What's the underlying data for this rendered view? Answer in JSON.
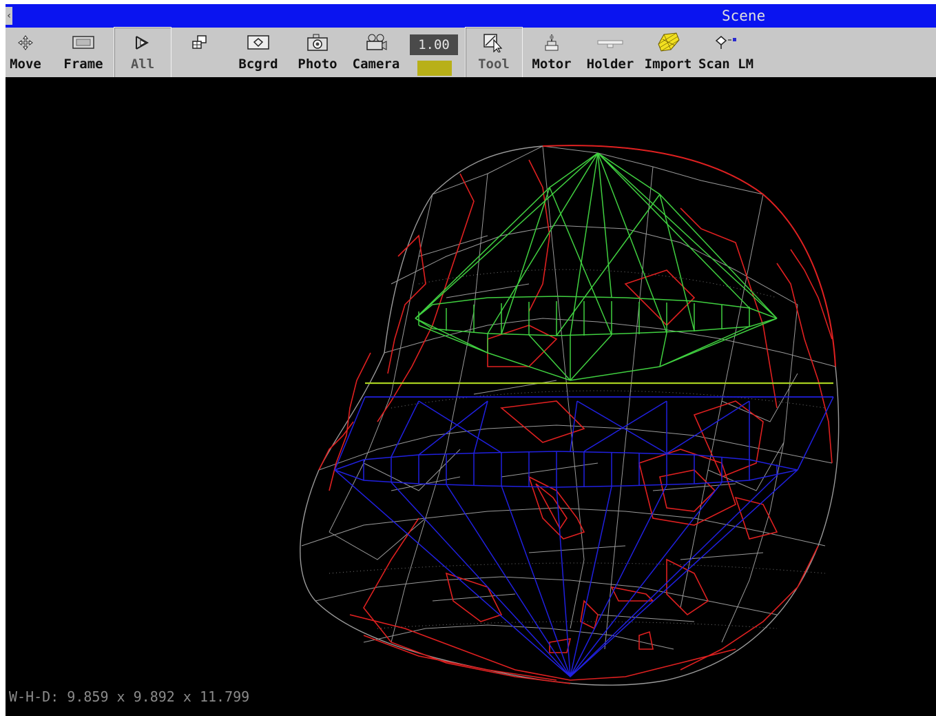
{
  "window": {
    "title": "Scene"
  },
  "toolbar": {
    "move_label": "Move",
    "frame_label": "Frame",
    "all_label": "All",
    "bcgrd_label": "Bcgrd",
    "photo_label": "Photo",
    "camera_label": "Camera",
    "zoom_value": "1.00",
    "tool_label": "Tool",
    "motor_label": "Motor",
    "holder_label": "Holder",
    "import_label": "Import",
    "scan_label": "Scan LM"
  },
  "status": {
    "dimensions": "W-H-D: 9.859 x 9.892 x 11.799"
  },
  "colors": {
    "titlebar": "#0a14f0",
    "toolbar": "#c8c8c8",
    "viewport": "#000000",
    "wire_gray": "#9a9a9a",
    "wire_red": "#e02020",
    "wire_green": "#40d040",
    "wire_blue": "#2020e0",
    "girdle_line": "#a8d020"
  }
}
